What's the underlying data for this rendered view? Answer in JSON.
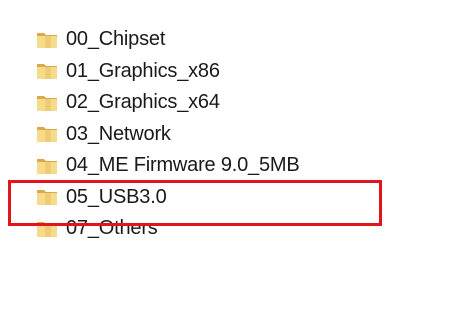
{
  "folders": [
    {
      "label": "00_Chipset",
      "icon": "folder-icon"
    },
    {
      "label": "01_Graphics_x86",
      "icon": "folder-icon"
    },
    {
      "label": "02_Graphics_x64",
      "icon": "folder-icon"
    },
    {
      "label": "03_Network",
      "icon": "folder-icon"
    },
    {
      "label": "04_ME Firmware 9.0_5MB",
      "icon": "folder-icon"
    },
    {
      "label": "05_USB3.0",
      "icon": "folder-icon"
    },
    {
      "label": "07_Others",
      "icon": "folder-icon"
    }
  ],
  "highlight": {
    "target": "04_ME Firmware 9.0_5MB",
    "color": "#e2151b"
  },
  "colors": {
    "folder_light": "#f6dc8a",
    "folder_dark": "#d9a94a",
    "text": "#1a1a1a"
  }
}
